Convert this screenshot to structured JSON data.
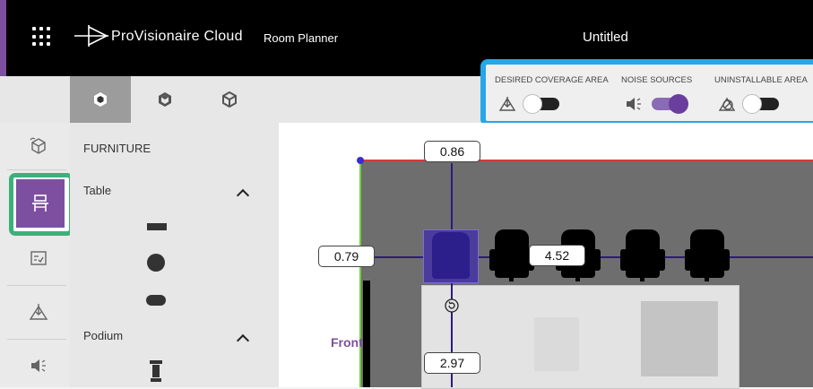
{
  "header": {
    "brand": "ProVisionaire Cloud",
    "app_name": "Room Planner",
    "document_title": "Untitled"
  },
  "view_tabs": [
    "3d-view-solid",
    "3d-view-outline",
    "3d-view-wire"
  ],
  "toggles": [
    {
      "label": "DESIRED COVERAGE AREA",
      "icon": "coverage-icon",
      "on": false
    },
    {
      "label": "NOISE SOURCES",
      "icon": "speaker-noise-icon",
      "on": true
    },
    {
      "label": "UNINSTALLABLE AREA",
      "icon": "no-install-icon",
      "on": false
    }
  ],
  "left_nav": [
    {
      "name": "room-shape",
      "icon": "cube-icon",
      "active": false
    },
    {
      "name": "furniture",
      "icon": "desk-icon",
      "active": true
    },
    {
      "name": "checklist",
      "icon": "checklist-icon",
      "active": false
    },
    {
      "name": "coverage",
      "icon": "coverage-icon",
      "active": false
    },
    {
      "name": "noise",
      "icon": "speaker-noise-icon",
      "active": false
    }
  ],
  "furniture_panel": {
    "title": "FURNITURE",
    "categories": [
      {
        "label": "Table",
        "items": [
          "rect-table",
          "round-table",
          "oval-table"
        ]
      },
      {
        "label": "Podium",
        "items": [
          "podium"
        ]
      }
    ]
  },
  "canvas": {
    "dimensions": {
      "top": "0.86",
      "left": "0.79",
      "between": "4.52",
      "below": "2.97"
    },
    "front_label": "Front",
    "colors": {
      "room_floor": "#6e6e6e",
      "wall_top": "#d43b3b",
      "wall_left": "#6fcf3a",
      "selection": "#4a3b9c"
    }
  },
  "highlights": {
    "toggle_panel": "#27a6e8",
    "nav_furniture": "#3bb17a"
  }
}
